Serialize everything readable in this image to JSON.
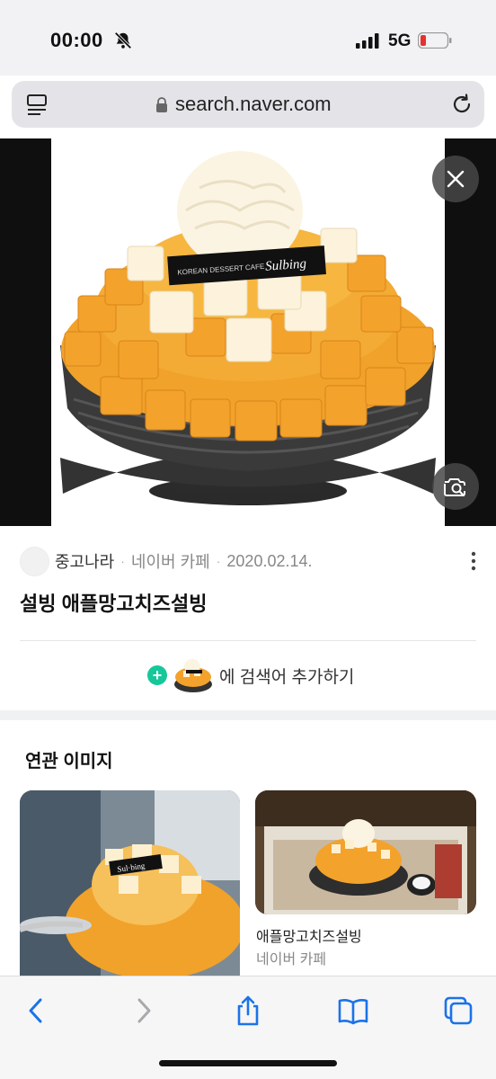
{
  "status_bar": {
    "time": "00:00",
    "network": "5G",
    "icons": [
      "bell-slash-icon",
      "signal-icon",
      "battery-icon"
    ]
  },
  "browser": {
    "url": "search.naver.com",
    "icons": [
      "tabs-overview-icon",
      "lock-icon",
      "reload-icon"
    ]
  },
  "image_viewer": {
    "logo_text": "KOREAN DESSERT CAFE Sulbing",
    "icons": [
      "close-icon",
      "visual-search-icon"
    ]
  },
  "result": {
    "source_name": "중고나라",
    "separator": "·",
    "source_type": "네이버 카페",
    "date": "2020.02.14.",
    "title": "설빙 애플망고치즈설빙",
    "add_prefix": "+",
    "add_label": "에 검색어 추가하기"
  },
  "related": {
    "heading": "연관 이미지",
    "items": [
      {
        "title": "",
        "source": ""
      },
      {
        "title": "애플망고치즈설빙",
        "source": "네이버 카페"
      }
    ]
  },
  "toolbar": {
    "icons": [
      "back-icon",
      "forward-icon",
      "share-icon",
      "bookmarks-icon",
      "tabs-icon"
    ]
  },
  "colors": {
    "accent_green": "#16c79a",
    "ios_blue": "#1a73e8",
    "mango": "#f5a623"
  }
}
